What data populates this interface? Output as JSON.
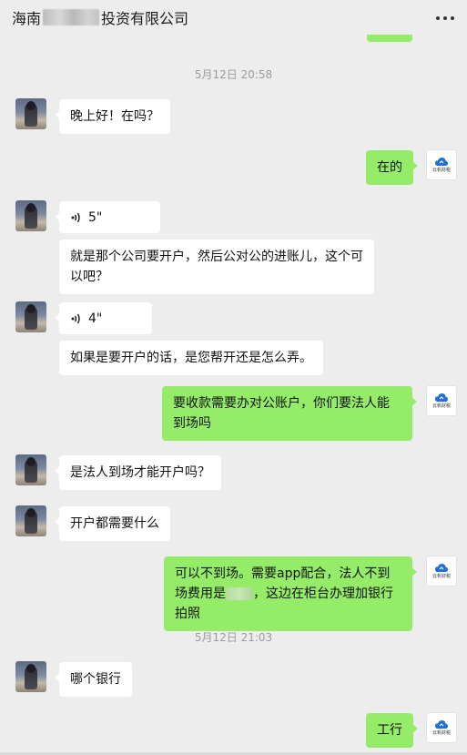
{
  "header": {
    "title_prefix": "海南",
    "title_suffix": "投资有限公司"
  },
  "timestamps": [
    "5月12日 20:58",
    "5月12日 21:03"
  ],
  "logo_text": "云帆财税",
  "messages": [
    {
      "from": "other",
      "type": "text",
      "text": "晚上好！在吗？"
    },
    {
      "from": "self",
      "type": "text",
      "text": "在的"
    },
    {
      "from": "other",
      "type": "voice",
      "duration": "5\""
    },
    {
      "from": "other",
      "type": "text",
      "text": "就是那个公司要开户，然后公对公的进账儿，这个可以吧？"
    },
    {
      "from": "other",
      "type": "voice",
      "duration": "4\""
    },
    {
      "from": "other",
      "type": "text",
      "text": "如果是要开户的话，是您帮开还是怎么弄。"
    },
    {
      "from": "self",
      "type": "text",
      "text": "要收款需要办对公账户，你们要法人能到场吗"
    },
    {
      "from": "other",
      "type": "text",
      "text": "是法人到场才能开户吗？"
    },
    {
      "from": "other",
      "type": "text",
      "text": "开户都需要什么"
    },
    {
      "from": "self",
      "type": "text",
      "text_1": "可以不到场。需要app配合，法人不到场费用是",
      "text_2": "，这边在柜台办理加银行拍照"
    },
    {
      "from": "other",
      "type": "text",
      "text": "哪个银行"
    },
    {
      "from": "self",
      "type": "text",
      "text": "工行"
    }
  ],
  "colors": {
    "background": "#ededed",
    "self_bubble": "#95ec69",
    "other_bubble": "#ffffff",
    "timestamp": "#9b9b9b"
  },
  "icons": {
    "more": "more-dots-icon",
    "voice": "voice-wave-icon",
    "logo": "cloud-logo-icon"
  }
}
